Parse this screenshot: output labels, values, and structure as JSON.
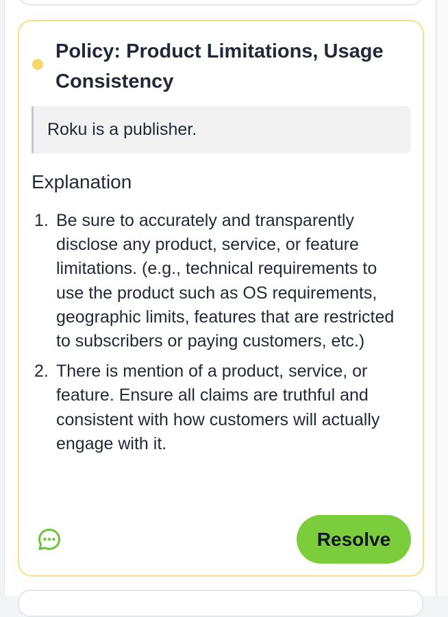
{
  "comment_card": {
    "status_color": "#f7d66a",
    "border_color": "#f8df86",
    "title": "Policy: Product Limitations, Usage Consistency",
    "quote": "Roku is a publisher.",
    "explanation_heading": "Explanation",
    "explanation_items": [
      {
        "number": "1.",
        "text": "Be sure to accurately and transparently disclose any product, service, or feature limitations. (e.g., technical requirements to use the product such as OS requirements, geographic limits, features that are restricted to subscribers or paying customers, etc.)"
      },
      {
        "number": "2.",
        "text": "There is mention of a product, service, or feature. Ensure all claims are truthful and consistent with how customers will actually engage with it."
      }
    ],
    "chat_icon": "chat-bubble-icon",
    "chat_icon_color": "#6cc23a",
    "resolve_label": "Resolve",
    "resolve_color": "#7ccd3c"
  }
}
